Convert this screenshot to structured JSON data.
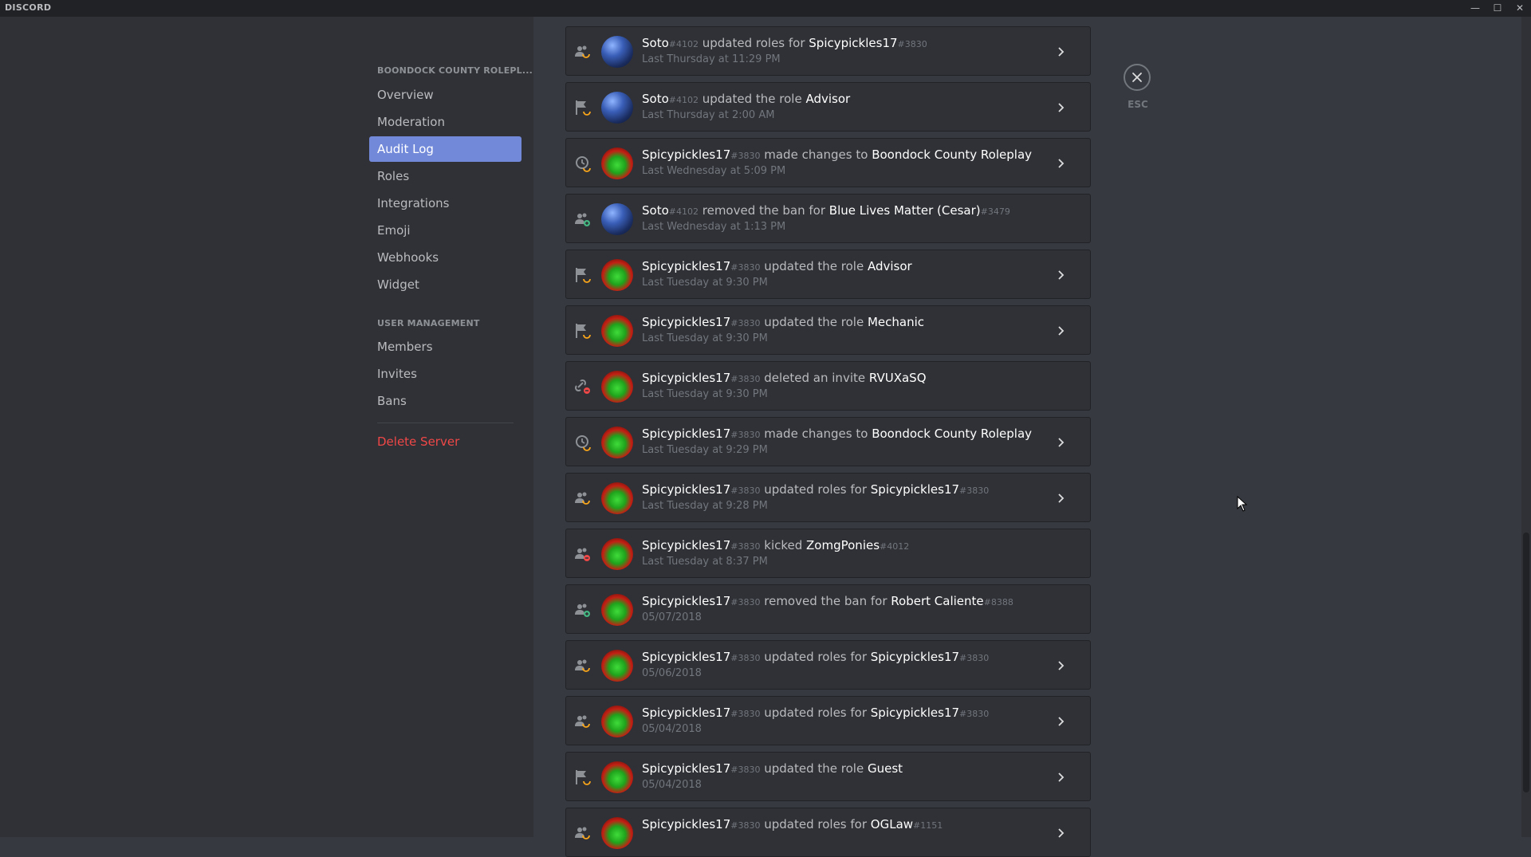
{
  "app": {
    "name": "DISCORD"
  },
  "window": {
    "minimize": "—",
    "maximize": "☐",
    "close": "✕"
  },
  "sidebar": {
    "server_header": "BOONDOCK COUNTY ROLEPL...",
    "items": [
      {
        "label": "Overview"
      },
      {
        "label": "Moderation"
      },
      {
        "label": "Audit Log"
      },
      {
        "label": "Roles"
      },
      {
        "label": "Integrations"
      },
      {
        "label": "Emoji"
      },
      {
        "label": "Webhooks"
      },
      {
        "label": "Widget"
      }
    ],
    "user_management_header": "USER MANAGEMENT",
    "user_items": [
      {
        "label": "Members"
      },
      {
        "label": "Invites"
      },
      {
        "label": "Bans"
      }
    ],
    "delete_label": "Delete Server"
  },
  "close": {
    "label": "ESC"
  },
  "colors": {
    "accent": "#7289da",
    "danger": "#f04747",
    "role_icon": "#faa61a",
    "add_icon": "#43b581",
    "remove_icon": "#f04747"
  },
  "audit_log": [
    {
      "icon": "members-update-icon",
      "avatar": "soto",
      "user": "Soto",
      "user_disc": "#4102",
      "action": " updated roles for ",
      "target": "Spicypickles17",
      "target_disc": "#3830",
      "time": "Last Thursday at 11:29 PM",
      "expandable": true
    },
    {
      "icon": "role-update-icon",
      "avatar": "soto",
      "user": "Soto",
      "user_disc": "#4102",
      "action": " updated the role ",
      "target": "Advisor",
      "target_disc": "",
      "time": "Last Thursday at 2:00 AM",
      "expandable": true
    },
    {
      "icon": "guild-update-icon",
      "avatar": "spicy",
      "user": "Spicypickles17",
      "user_disc": "#3830",
      "action": " made changes to ",
      "target": "Boondock County Roleplay",
      "target_disc": "",
      "time": "Last Wednesday at 5:09 PM",
      "expandable": true
    },
    {
      "icon": "member-unban-icon",
      "avatar": "soto",
      "user": "Soto",
      "user_disc": "#4102",
      "action": " removed the ban for ",
      "target": "Blue Lives Matter (Cesar)",
      "target_disc": "#3479",
      "time": "Last Wednesday at 1:13 PM",
      "expandable": false
    },
    {
      "icon": "role-update-icon",
      "avatar": "spicy",
      "user": "Spicypickles17",
      "user_disc": "#3830",
      "action": " updated the role ",
      "target": "Advisor",
      "target_disc": "",
      "time": "Last Tuesday at 9:30 PM",
      "expandable": true
    },
    {
      "icon": "role-update-icon",
      "avatar": "spicy",
      "user": "Spicypickles17",
      "user_disc": "#3830",
      "action": " updated the role ",
      "target": "Mechanic",
      "target_disc": "",
      "time": "Last Tuesday at 9:30 PM",
      "expandable": true
    },
    {
      "icon": "invite-delete-icon",
      "avatar": "spicy",
      "user": "Spicypickles17",
      "user_disc": "#3830",
      "action": " deleted an invite ",
      "target": "RVUXaSQ",
      "target_disc": "",
      "time": "Last Tuesday at 9:30 PM",
      "expandable": false
    },
    {
      "icon": "guild-update-icon",
      "avatar": "spicy",
      "user": "Spicypickles17",
      "user_disc": "#3830",
      "action": " made changes to ",
      "target": "Boondock County Roleplay",
      "target_disc": "",
      "time": "Last Tuesday at 9:29 PM",
      "expandable": true
    },
    {
      "icon": "members-update-icon",
      "avatar": "spicy",
      "user": "Spicypickles17",
      "user_disc": "#3830",
      "action": " updated roles for ",
      "target": "Spicypickles17",
      "target_disc": "#3830",
      "time": "Last Tuesday at 9:28 PM",
      "expandable": true
    },
    {
      "icon": "member-kick-icon",
      "avatar": "spicy",
      "user": "Spicypickles17",
      "user_disc": "#3830",
      "action": " kicked ",
      "target": "ZomgPonies",
      "target_disc": "#4012",
      "time": "Last Tuesday at 8:37 PM",
      "expandable": false
    },
    {
      "icon": "member-unban-icon",
      "avatar": "spicy",
      "user": "Spicypickles17",
      "user_disc": "#3830",
      "action": " removed the ban for ",
      "target": "Robert Caliente",
      "target_disc": "#8388",
      "time": "05/07/2018",
      "expandable": false
    },
    {
      "icon": "members-update-icon",
      "avatar": "spicy",
      "user": "Spicypickles17",
      "user_disc": "#3830",
      "action": " updated roles for ",
      "target": "Spicypickles17",
      "target_disc": "#3830",
      "time": "05/06/2018",
      "expandable": true
    },
    {
      "icon": "members-update-icon",
      "avatar": "spicy",
      "user": "Spicypickles17",
      "user_disc": "#3830",
      "action": " updated roles for ",
      "target": "Spicypickles17",
      "target_disc": "#3830",
      "time": "05/04/2018",
      "expandable": true
    },
    {
      "icon": "role-update-icon",
      "avatar": "spicy",
      "user": "Spicypickles17",
      "user_disc": "#3830",
      "action": " updated the role ",
      "target": "Guest",
      "target_disc": "",
      "time": "05/04/2018",
      "expandable": true
    },
    {
      "icon": "members-update-icon",
      "avatar": "spicy",
      "user": "Spicypickles17",
      "user_disc": "#3830",
      "action": " updated roles for ",
      "target": "OGLaw",
      "target_disc": "#1151",
      "time": "",
      "expandable": true
    }
  ]
}
